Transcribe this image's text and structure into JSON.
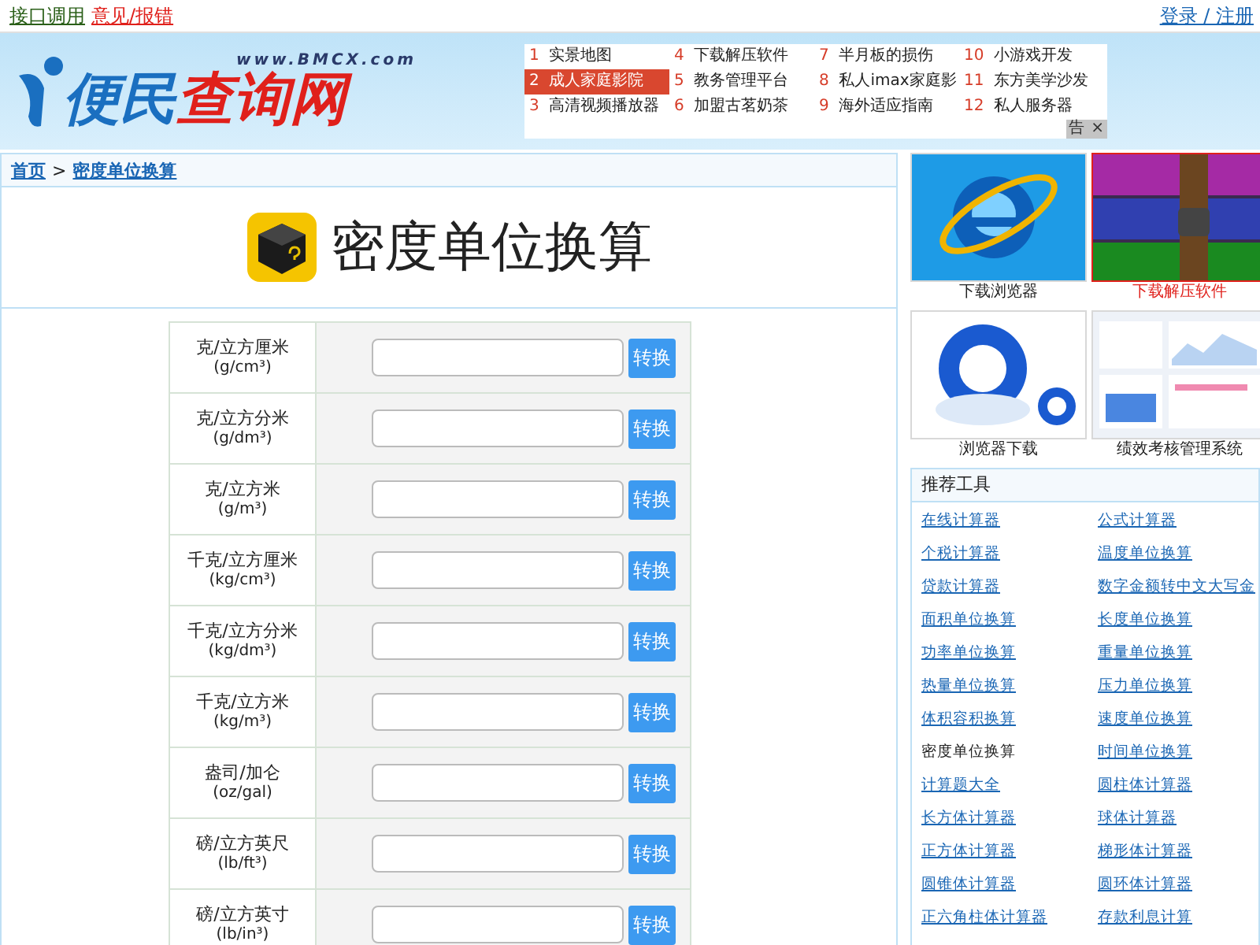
{
  "top_bar": {
    "links": [
      {
        "text": "接口调用",
        "kind": "plain"
      },
      {
        "text": "意见/报错",
        "kind": "alert"
      }
    ],
    "account": "登录 / 注册"
  },
  "header": {
    "logo": {
      "domain": "www.BMCX.com",
      "part_1": "便民",
      "part_2": "查询网"
    },
    "ad_links": [
      {
        "number": "1",
        "text": "实景地图",
        "selected": false
      },
      {
        "number": "2",
        "text": "成人家庭影院",
        "selected": true
      },
      {
        "number": "3",
        "text": "高清视频播放器",
        "selected": false
      },
      {
        "number": "4",
        "text": "下载解压软件",
        "selected": false
      },
      {
        "number": "5",
        "text": "教务管理平台",
        "selected": false
      },
      {
        "number": "6",
        "text": "加盟古茗奶茶",
        "selected": false
      },
      {
        "number": "7",
        "text": "半月板的损伤",
        "selected": false
      },
      {
        "number": "8",
        "text": "私人imax家庭影",
        "selected": false
      },
      {
        "number": "9",
        "text": "海外适应指南",
        "selected": false
      },
      {
        "number": "10",
        "text": "小游戏开发",
        "selected": false
      },
      {
        "number": "11",
        "text": "东方美学沙发",
        "selected": false
      },
      {
        "number": "12",
        "text": "私人服务器",
        "selected": false
      }
    ],
    "ad_label": "告",
    "ad_close": "×"
  },
  "breadcrumb": {
    "home": "首页",
    "separator": ">",
    "current": "密度单位换算"
  },
  "page_title": "密度单位换算",
  "converter": {
    "rows": [
      {
        "unit": "克/立方厘米",
        "symbol": "(g/cm³)",
        "button": "转换"
      },
      {
        "unit": "克/立方分米",
        "symbol": "(g/dm³)",
        "button": "转换"
      },
      {
        "unit": "克/立方米",
        "symbol": "(g/m³)",
        "button": "转换"
      },
      {
        "unit": "千克/立方厘米",
        "symbol": "(kg/cm³)",
        "button": "转换"
      },
      {
        "unit": "千克/立方分米",
        "symbol": "(kg/dm³)",
        "button": "转换"
      },
      {
        "unit": "千克/立方米",
        "symbol": "(kg/m³)",
        "button": "转换"
      },
      {
        "unit": "盎司/加仑",
        "symbol": "(oz/gal)",
        "button": "转换"
      },
      {
        "unit": "磅/立方英尺",
        "symbol": "(lb/ft³)",
        "button": "转换"
      },
      {
        "unit": "磅/立方英寸",
        "symbol": "(lb/in³)",
        "button": "转换"
      }
    ]
  },
  "promo_tiles": [
    {
      "caption": "下载浏览器",
      "highlighted": false,
      "kind": "browser"
    },
    {
      "caption": "下载解压软件",
      "highlighted": true,
      "kind": "archive"
    },
    {
      "caption": "浏览器下载",
      "highlighted": false,
      "kind": "ring"
    },
    {
      "caption": "绩效考核管理系统",
      "highlighted": false,
      "kind": "dashboard"
    }
  ],
  "recommended_tools": {
    "title": "推荐工具",
    "links": [
      {
        "text": "在线计算器",
        "current": false
      },
      {
        "text": "公式计算器",
        "current": false
      },
      {
        "text": "个税计算器",
        "current": false
      },
      {
        "text": "温度单位换算",
        "current": false
      },
      {
        "text": "贷款计算器",
        "current": false
      },
      {
        "text": "数字金额转中文大写金",
        "current": false
      },
      {
        "text": "面积单位换算",
        "current": false
      },
      {
        "text": "长度单位换算",
        "current": false
      },
      {
        "text": "功率单位换算",
        "current": false
      },
      {
        "text": "重量单位换算",
        "current": false
      },
      {
        "text": "热量单位换算",
        "current": false
      },
      {
        "text": "压力单位换算",
        "current": false
      },
      {
        "text": "体积容积换算",
        "current": false
      },
      {
        "text": "速度单位换算",
        "current": false
      },
      {
        "text": "密度单位换算",
        "current": true
      },
      {
        "text": "时间单位换算",
        "current": false
      },
      {
        "text": "计算题大全",
        "current": false
      },
      {
        "text": "圆柱体计算器",
        "current": false
      },
      {
        "text": "长方体计算器",
        "current": false
      },
      {
        "text": "球体计算器",
        "current": false
      },
      {
        "text": "正方体计算器",
        "current": false
      },
      {
        "text": "梯形体计算器",
        "current": false
      },
      {
        "text": "圆锥体计算器",
        "current": false
      },
      {
        "text": "圆环体计算器",
        "current": false
      },
      {
        "text": "正六角柱体计算器",
        "current": false
      },
      {
        "text": "存款利息计算",
        "current": false
      }
    ]
  }
}
